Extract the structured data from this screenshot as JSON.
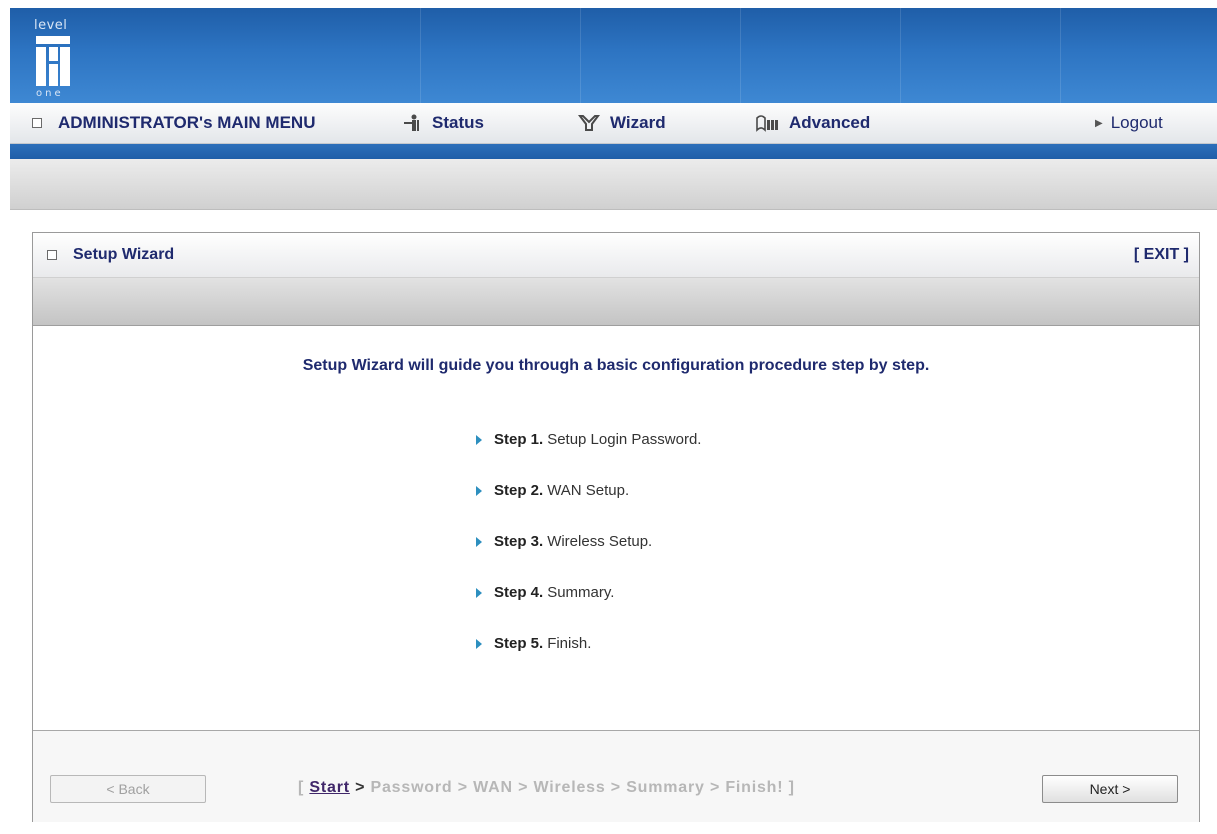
{
  "brand": {
    "logo_top": "level",
    "logo_bottom": "one"
  },
  "menu": {
    "admin_label": "ADMINISTRATOR's MAIN MENU",
    "status": "Status",
    "wizard": "Wizard",
    "advanced": "Advanced",
    "logout": "Logout",
    "status_icon": "person-icon",
    "wizard_icon": "wizard-icon",
    "advanced_icon": "advanced-icon"
  },
  "panel": {
    "title": "Setup Wizard",
    "exit": "[ EXIT ]",
    "intro": "Setup Wizard will guide you through a basic configuration procedure step by step."
  },
  "steps": [
    {
      "num": "Step 1.",
      "text": "Setup Login Password."
    },
    {
      "num": "Step 2.",
      "text": "WAN Setup."
    },
    {
      "num": "Step 3.",
      "text": "Wireless Setup."
    },
    {
      "num": "Step 4.",
      "text": "Summary."
    },
    {
      "num": "Step 5.",
      "text": "Finish."
    }
  ],
  "footer": {
    "back": "< Back",
    "next": "Next >",
    "crumb_open": "[",
    "crumb_start": "Start",
    "crumb_first_sep": ">",
    "crumb_rest": "Password > WAN > Wireless > Summary > Finish! ]"
  },
  "colors": {
    "header_blue": "#2d74c2",
    "menu_text": "#1f2a6e",
    "arrow": "#2d8fbf",
    "active_crumb": "#40276a",
    "inactive_crumb": "#b7b7b7"
  }
}
